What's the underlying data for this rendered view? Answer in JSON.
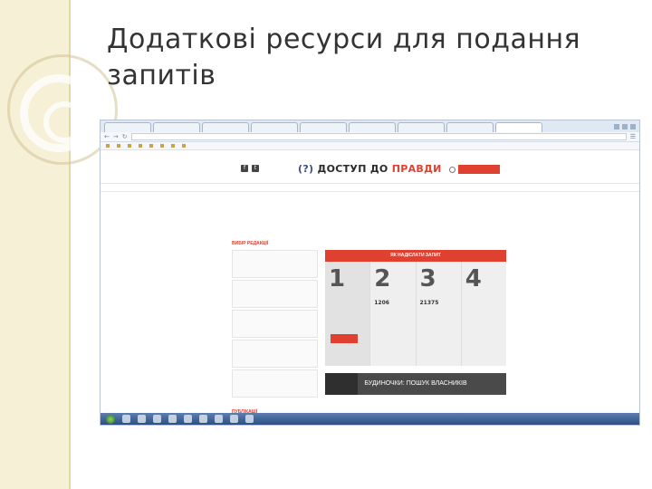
{
  "slide": {
    "title": "Додаткові ресурси для подання запитів"
  },
  "browser": {
    "tabs": [
      "",
      "",
      "",
      "",
      "",
      "",
      "",
      "",
      "",
      "",
      ""
    ],
    "url": "",
    "bookmarks": [
      "",
      "",
      "",
      "",
      "",
      "",
      "",
      ""
    ]
  },
  "site": {
    "top_nav": [
      "",
      "",
      "",
      "",
      "",
      "",
      "",
      "",
      "",
      "",
      ""
    ],
    "logo": {
      "q": "(?)",
      "part1": "ДОСТУП ДО",
      "part2": "ПРАВДИ"
    },
    "login_label": "",
    "main_nav": [
      "",
      "",
      "",
      "",
      "",
      ""
    ],
    "editors_choice_label": "ВИБІР РЕДАКЦІЇ",
    "howto": {
      "title": "ЯК НАДІСЛАТИ ЗАПИТ",
      "steps": [
        {
          "num": "1",
          "text": "",
          "button": "",
          "count": "",
          "count_label": ""
        },
        {
          "num": "2",
          "text": "",
          "button": "",
          "count": "1206",
          "count_label": ""
        },
        {
          "num": "3",
          "text": "",
          "button": "",
          "count": "21375",
          "count_label": ""
        },
        {
          "num": "4",
          "text": "",
          "button": "",
          "count": "",
          "count_label": ""
        }
      ]
    },
    "banner": "БУДИНОЧКИ: ПОШУК ВЛАСНИКІВ",
    "news": [
      "",
      "",
      "",
      "",
      ""
    ],
    "publications_label": "ПУБЛІКАЦІЇ",
    "cta": {
      "heading": "",
      "text": ""
    }
  },
  "taskbar": {
    "clock": ""
  }
}
